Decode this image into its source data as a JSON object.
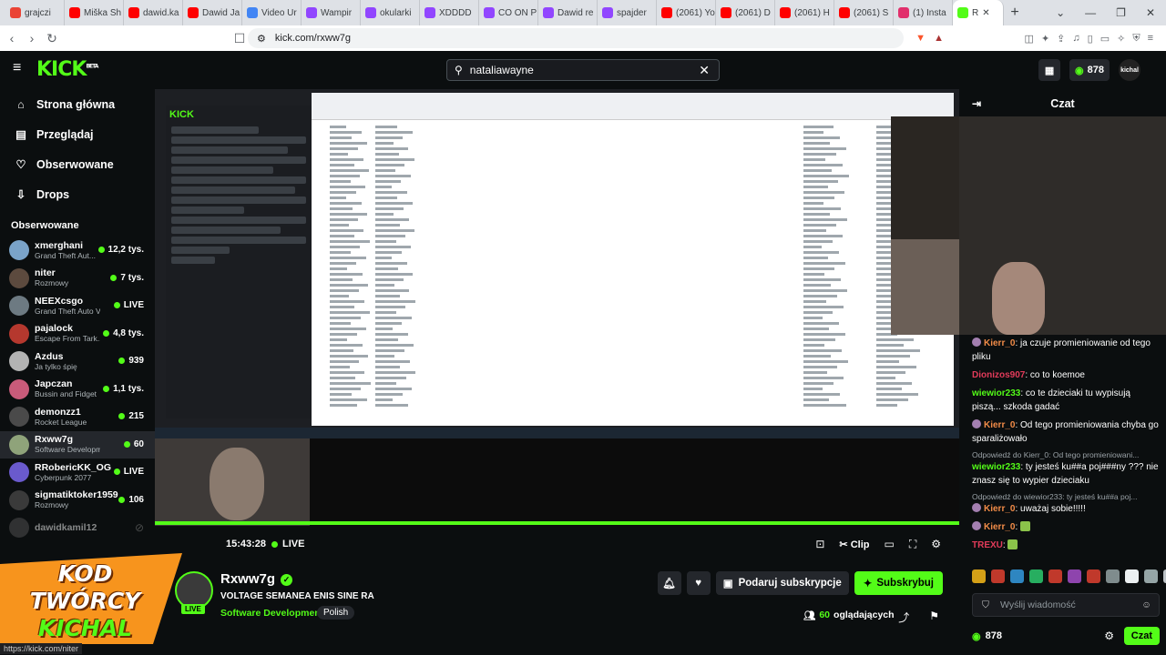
{
  "browser": {
    "tabs": [
      {
        "label": "grajczi",
        "color": "#ea4335"
      },
      {
        "label": "Miška Sh",
        "color": "#ff0000"
      },
      {
        "label": "dawid.ka",
        "color": "#ff0000"
      },
      {
        "label": "Dawid Ja",
        "color": "#ff0000"
      },
      {
        "label": "Video Ur",
        "color": "#4285f4"
      },
      {
        "label": "Wampir",
        "color": "#9146ff"
      },
      {
        "label": "okularki",
        "color": "#9146ff"
      },
      {
        "label": "XDDDD",
        "color": "#9146ff"
      },
      {
        "label": "CO ON P",
        "color": "#9146ff"
      },
      {
        "label": "Dawid re",
        "color": "#9146ff"
      },
      {
        "label": "spajder",
        "color": "#9146ff"
      },
      {
        "label": "(2061) Yo",
        "color": "#ff0000"
      },
      {
        "label": "(2061) D",
        "color": "#ff0000"
      },
      {
        "label": "(2061) H",
        "color": "#ff0000"
      },
      {
        "label": "(2061) S",
        "color": "#ff0000"
      },
      {
        "label": "(1) Insta",
        "color": "#e1306c"
      }
    ],
    "active_tab": "R",
    "url": "kick.com/rxww7g"
  },
  "header": {
    "logo": "KICK",
    "logo_sup": "BETA",
    "search_value": "nataliawayne",
    "points": "878",
    "username": "kichal"
  },
  "sidebar": {
    "nav": [
      {
        "label": "Strona główna",
        "icon": "home-icon",
        "glyph": "⌂"
      },
      {
        "label": "Przeglądaj",
        "icon": "browse-icon",
        "glyph": "▤"
      },
      {
        "label": "Obserwowane",
        "icon": "heart-icon",
        "glyph": "♡"
      },
      {
        "label": "Drops",
        "icon": "drops-icon",
        "glyph": "⇩"
      }
    ],
    "following_title": "Obserwowane",
    "following": [
      {
        "name": "xmerghani",
        "category": "Grand Theft Aut...",
        "viewers": "12,2 tys.",
        "color": "#7aa3c9"
      },
      {
        "name": "niter",
        "category": "Rozmowy",
        "viewers": "7 tys.",
        "color": "#5c4a3e"
      },
      {
        "name": "NEEXcsgo",
        "category": "Grand Theft Auto V (...",
        "viewers": "LIVE",
        "color": "#6d7a82"
      },
      {
        "name": "pajalock",
        "category": "Escape From Tark...",
        "viewers": "4,8 tys.",
        "color": "#b5382e"
      },
      {
        "name": "Azdus",
        "category": "Ja tylko śpię",
        "viewers": "939",
        "color": "#b3b3b3"
      },
      {
        "name": "Japczan",
        "category": "Bussin and Fidget",
        "viewers": "1,1 tys.",
        "color": "#c95b7a"
      },
      {
        "name": "demonzz1",
        "category": "Rocket League",
        "viewers": "215",
        "color": "#4a4a4a"
      },
      {
        "name": "Rxww7g",
        "category": "Software Development",
        "viewers": "60",
        "color": "#8fa37a",
        "active": true
      },
      {
        "name": "RRobericKK_OG",
        "category": "Cyberpunk 2077",
        "viewers": "LIVE",
        "color": "#6a5acd"
      },
      {
        "name": "sigmatiktoker1959",
        "category": "Rozmowy",
        "viewers": "106",
        "color": "#3a3a3a"
      },
      {
        "name": "dawidkamil12",
        "category": "",
        "viewers": "",
        "color": "#555555",
        "offline": true
      }
    ]
  },
  "video": {
    "elapsed": "15:43:28",
    "live_label": "LIVE",
    "clip_label": "Clip"
  },
  "channel": {
    "name": "Rxww7g",
    "live_badge": "LIVE",
    "title": "VOLTAGE SEMANEA ENIS SINE RA",
    "category": "Software Development",
    "tag": "Polish",
    "gift_label": "Podaruj subskrypcje",
    "subscribe_label": "Subskrybuj",
    "viewers_count": "60",
    "viewers_label": "oglądających"
  },
  "promo": {
    "line1": "KOD TWÓRCY",
    "line2": "KICHAL"
  },
  "status_url": "https://kick.com/niter",
  "chat": {
    "title": "Czat",
    "messages": [
      {
        "user": "Kierr_0",
        "color": "#f28c48",
        "badge": true,
        "text": "ja czuje promieniowanie od tego pliku"
      },
      {
        "user": "Dionizos907",
        "color": "#e23b5a",
        "badge": false,
        "text": "co to koemoe"
      },
      {
        "user": "wiewior233",
        "color": "#53fc18",
        "badge": false,
        "text": "co te dzieciaki tu wypisują piszą... szkoda gadać"
      },
      {
        "user": "Kierr_0",
        "color": "#f28c48",
        "badge": true,
        "text": "Od tego promieniowania chyba go sparaliżowało"
      },
      {
        "reply": "Odpowiedź do Kierr_0: Od tego promieniowani...",
        "user": "wiewior233",
        "color": "#53fc18",
        "badge": false,
        "text": "ty jesteś ku##a poj###ny ??? nie znasz się to wypier dzieciaku"
      },
      {
        "reply": "Odpowiedź do wiewior233: ty jesteś ku##a poj...",
        "user": "Kierr_0",
        "color": "#f28c48",
        "badge": true,
        "text": "uważaj sobie!!!!!"
      },
      {
        "user": "Kierr_0",
        "color": "#f28c48",
        "badge": true,
        "text": "",
        "emote": true
      },
      {
        "user": "TREXU",
        "color": "#e23b5a",
        "badge": false,
        "text": "",
        "emote": true
      }
    ],
    "emote_colors": [
      "#d4a017",
      "#c0392b",
      "#2e86c1",
      "#27ae60",
      "#c0392b",
      "#8e44ad",
      "#c0392b",
      "#7f8c8d",
      "#ecf0f1",
      "#95a5a6",
      "#bdc3c7"
    ],
    "emote_texts": {
      "wowo": "WOWO"
    },
    "input_placeholder": "Wyślij wiadomość",
    "points": "878",
    "send_label": "Czat"
  }
}
